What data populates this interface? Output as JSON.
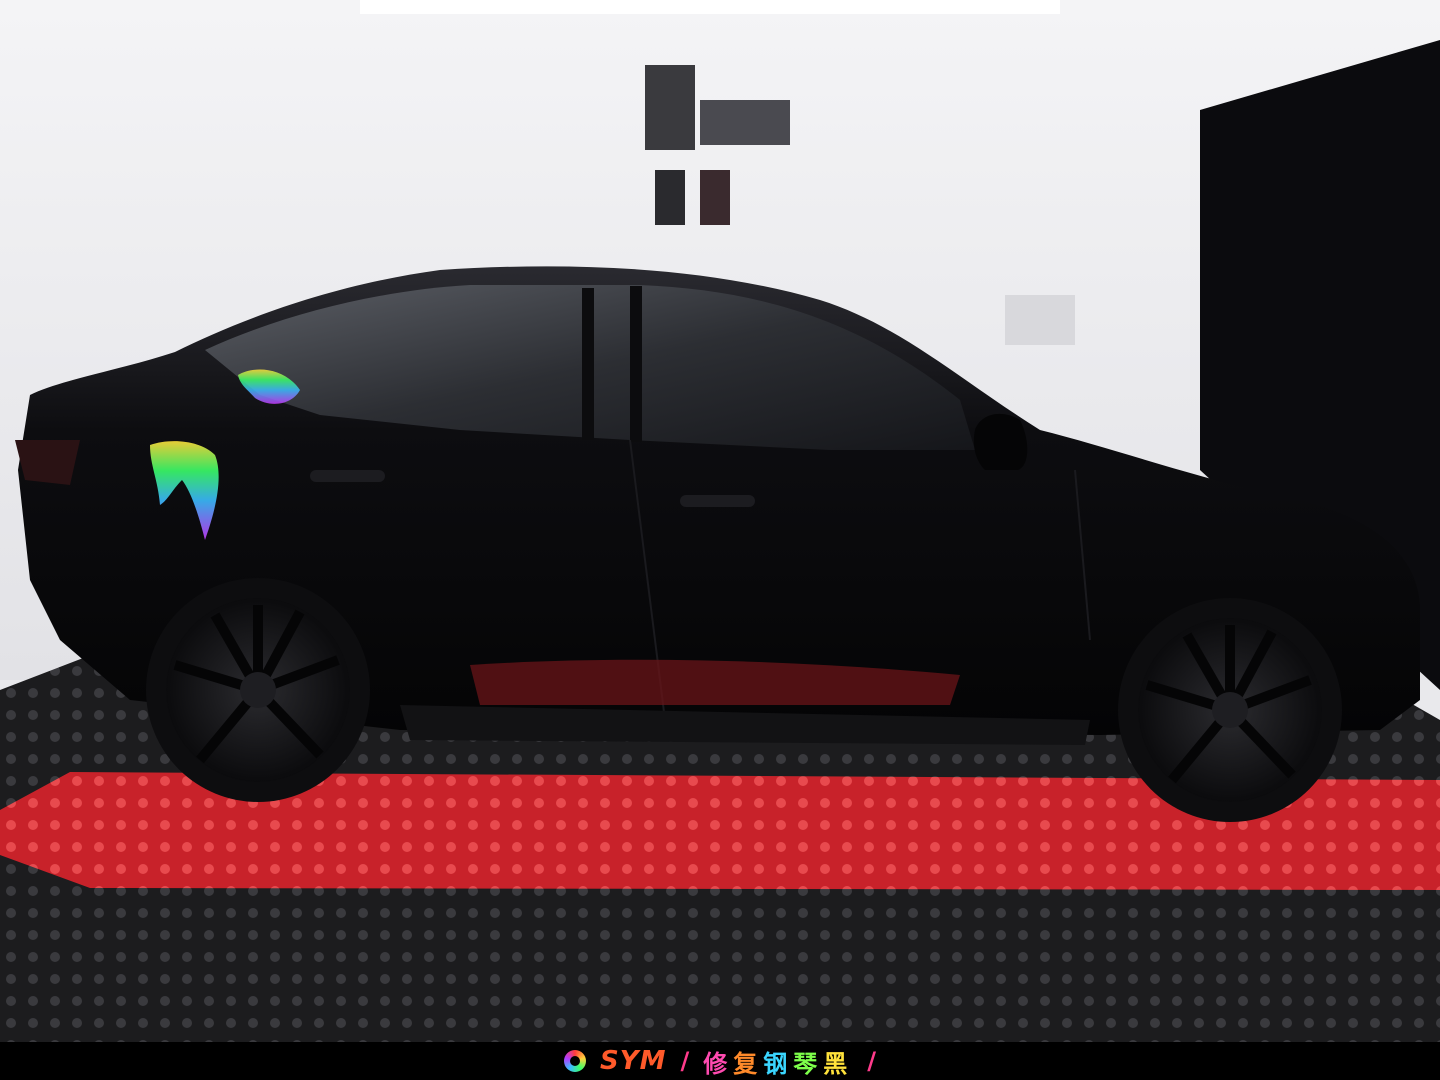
{
  "caption": {
    "brand": "SYM",
    "separator_left": "/",
    "separator_right": "/",
    "slogan_chars": [
      "修",
      "复",
      "钢",
      "琴",
      "黑"
    ]
  },
  "colors": {
    "wall": "#ebebee",
    "car_body": "#0a0a0c",
    "floor_black": "#1b1b1d",
    "floor_red": "#d8252b"
  }
}
